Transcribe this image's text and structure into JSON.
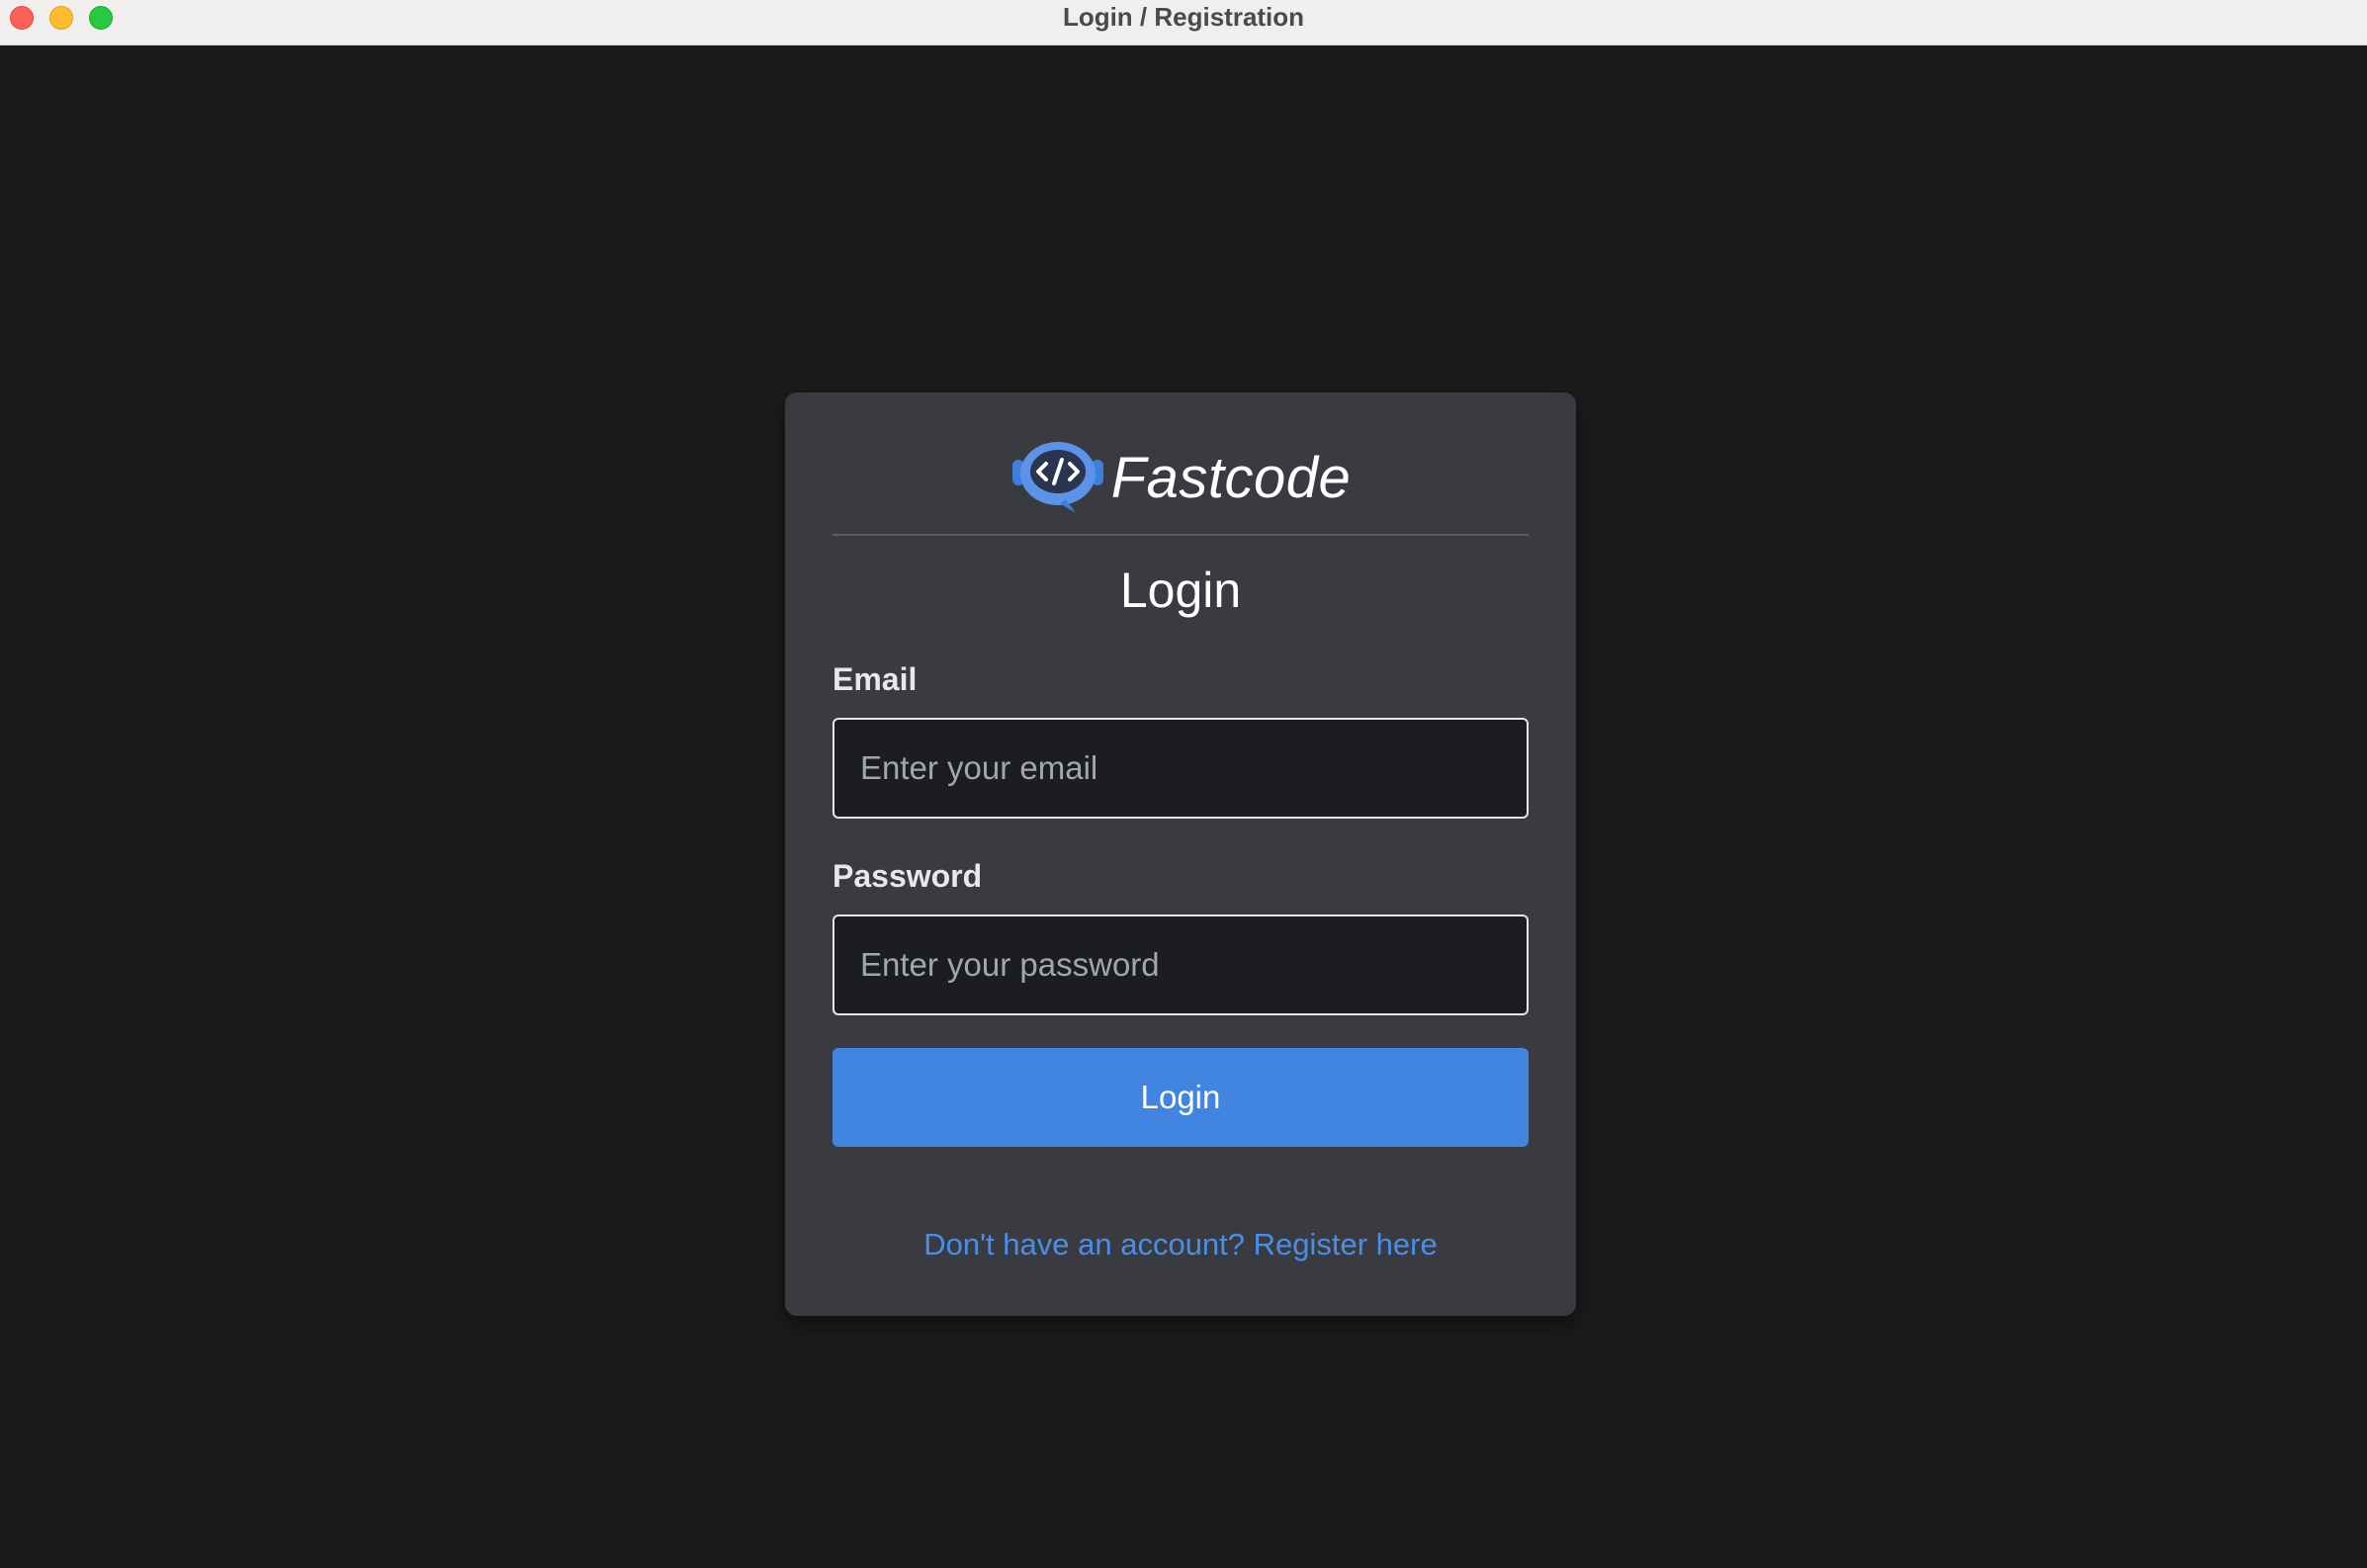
{
  "window": {
    "title": "Login / Registration"
  },
  "brand": {
    "name": "Fastcode",
    "logo_icon": "code-chat-bubble-icon"
  },
  "form": {
    "heading": "Login",
    "email": {
      "label": "Email",
      "placeholder": "Enter your email",
      "value": ""
    },
    "password": {
      "label": "Password",
      "placeholder": "Enter your password",
      "value": ""
    },
    "submit_label": "Login",
    "register_link": "Don't have an account? Register here"
  },
  "colors": {
    "background": "#1a1c1c",
    "card": "#3a3b41",
    "accent": "#4185e0",
    "link": "#4a8ee6"
  }
}
